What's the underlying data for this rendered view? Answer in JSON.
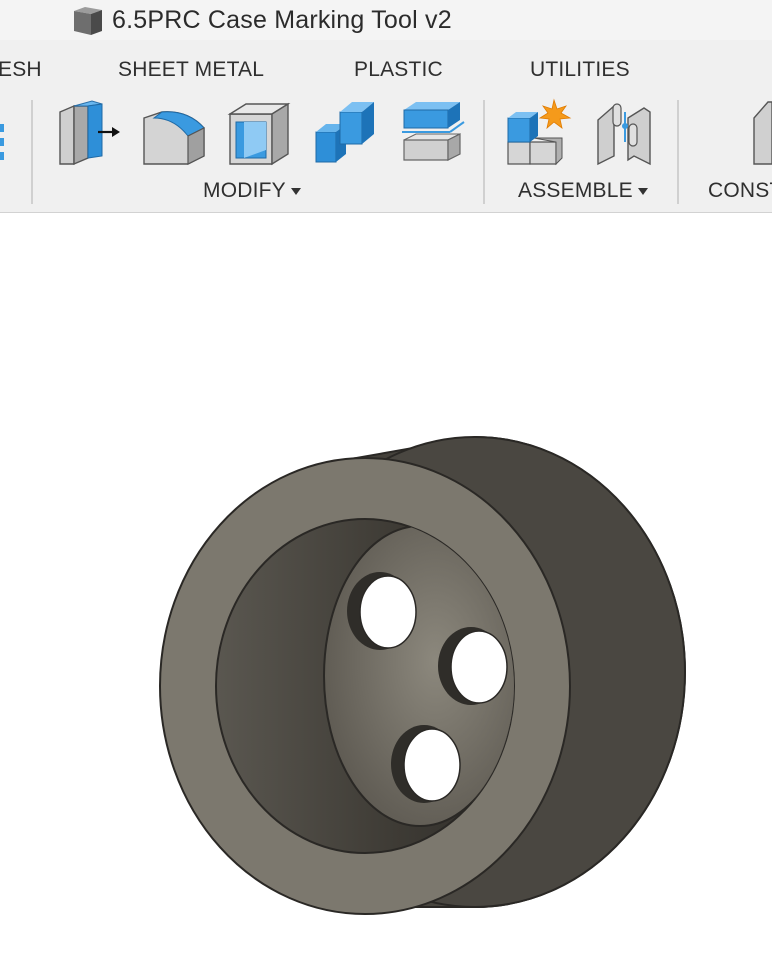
{
  "document": {
    "title": "6.5PRC Case Marking Tool v2",
    "icon": "box-icon"
  },
  "toolbar": {
    "tabs": [
      {
        "label": "ESH"
      },
      {
        "label": "SHEET METAL"
      },
      {
        "label": "PLASTIC"
      },
      {
        "label": "UTILITIES"
      }
    ],
    "groups": {
      "modify": {
        "label": "MODIFY",
        "tools": [
          "press-pull-icon",
          "fillet-icon",
          "shell-icon",
          "combine-icon",
          "offset-face-icon"
        ]
      },
      "assemble": {
        "label": "ASSEMBLE",
        "tools": [
          "new-component-icon",
          "joint-icon"
        ]
      },
      "construct": {
        "label": "CONST",
        "tools": [
          "offset-plane-icon"
        ]
      }
    },
    "partial_tool_icon": "partial-tool-icon"
  },
  "viewport": {
    "model_icon": "cylindrical-cup-with-three-holes",
    "colors": {
      "face_light": "#7c786e",
      "face_dark": "#4d4a43",
      "accent_blue": "#3a9ae0",
      "accent_orange": "#f59a1b"
    }
  }
}
